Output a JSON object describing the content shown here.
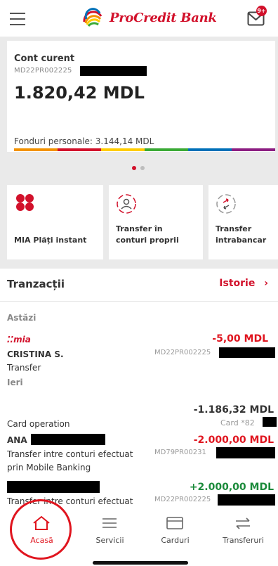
{
  "header": {
    "bank_name": "ProCredit Bank",
    "mail_badge": "9+"
  },
  "account": {
    "title": "Cont curent",
    "iban": "MD22PR002225",
    "balance": "1.820,42 MDL",
    "personal_funds": "Fonduri personale: 3.144,14 MDL"
  },
  "pager": {
    "active_index": 0,
    "count": 2
  },
  "quick_actions": [
    {
      "label": "MIA Plăți instant",
      "icon": "mia-icon"
    },
    {
      "label_line1": "Transfer în",
      "label_line2": "conturi proprii",
      "icon": "own-accounts-transfer-icon"
    },
    {
      "label_line1": "Transfer",
      "label_line2": "intrabancar",
      "icon": "intrabank-transfer-icon"
    }
  ],
  "transactions": {
    "title": "Tranzacții",
    "history_label": "Istorie",
    "today_label": "Astăzi",
    "yesterday_label": "Ieri",
    "items": [
      {
        "logo": "mia",
        "name": "CRISTINA S.",
        "type": "Transfer",
        "amount": "-5,00 MDL",
        "account": "MD22PR002225"
      },
      {
        "description": "Card operation",
        "amount": "-1.186,32 MDL",
        "account": "Card *82"
      },
      {
        "name": "ANA",
        "description_line1": "Transfer intre conturi efectuat",
        "description_line2": "prin Mobile Banking",
        "amount": "-2.000,00 MDL",
        "account": "MD79PR00231"
      },
      {
        "description_line1": "Transfer intre conturi efectuat",
        "amount": "+2.000,00 MDL",
        "account": "MD22PR002225"
      }
    ]
  },
  "bottom_nav": [
    {
      "label": "Acasă",
      "active": true
    },
    {
      "label": "Servicii"
    },
    {
      "label": "Carduri"
    },
    {
      "label": "Transferuri"
    }
  ],
  "colors": {
    "brand_red": "#d2112b",
    "positive_green": "#1a8a3a",
    "negative_red": "#e0151f"
  }
}
